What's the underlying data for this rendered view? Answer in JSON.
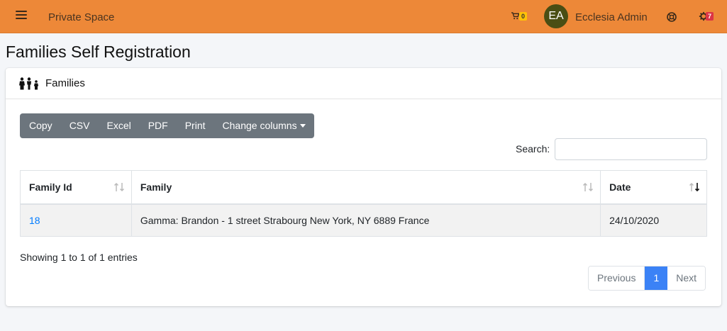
{
  "navbar": {
    "brand": "Private Space",
    "cart_badge": "0",
    "avatar_initials": "EA",
    "user_name": "Ecclesia Admin",
    "settings_badge": "7",
    "color": "#ed8838"
  },
  "page": {
    "title": "Families Self Registration"
  },
  "card": {
    "title": "Families",
    "icon": "family-icon"
  },
  "toolbar": {
    "copy": "Copy",
    "csv": "CSV",
    "excel": "Excel",
    "pdf": "PDF",
    "print": "Print",
    "change_columns": "Change columns"
  },
  "search": {
    "label": "Search:",
    "value": ""
  },
  "table": {
    "headers": [
      "Family Id",
      "Family",
      "Date"
    ],
    "rows": [
      {
        "id": "18",
        "family": "Gamma: Brandon - 1 street Strabourg New York, NY 6889 France",
        "date": "24/10/2020"
      }
    ]
  },
  "footer": {
    "info": "Showing 1 to 1 of 1 entries",
    "previous": "Previous",
    "current_page": "1",
    "next": "Next"
  }
}
